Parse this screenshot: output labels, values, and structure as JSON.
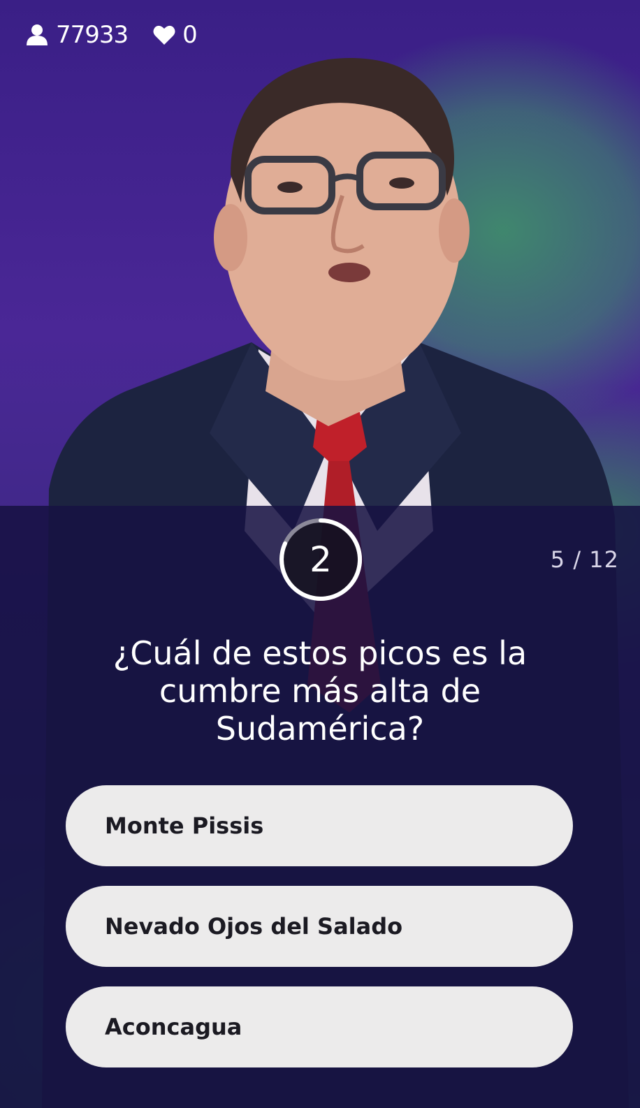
{
  "stats": {
    "viewers": "77933",
    "viewers_icon": "user-icon",
    "lives": "0",
    "lives_icon": "heart-icon"
  },
  "timer": {
    "seconds": "2"
  },
  "progress": "5 / 12",
  "question": "¿Cuál de estos picos es la cumbre más alta de Sudamérica?",
  "answers": [
    {
      "label": "Monte Pissis"
    },
    {
      "label": "Nevado Ojos del Salado"
    },
    {
      "label": "Aconcagua"
    }
  ],
  "colors": {
    "panel": "#16124280",
    "answer_bg": "#ecebeb",
    "answer_text": "#1b1a22",
    "tie": "#c0202a",
    "suit": "#1c2340"
  }
}
